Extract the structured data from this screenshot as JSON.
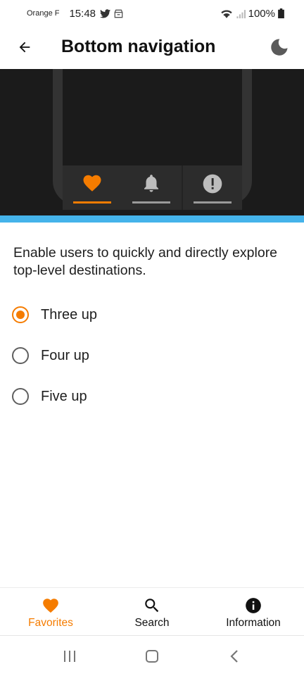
{
  "status_bar": {
    "carrier": "Orange F",
    "time": "15:48",
    "battery": "100%"
  },
  "app_bar": {
    "title": "Bottom navigation"
  },
  "description": "Enable users to quickly and directly explore top-level destinations.",
  "options": [
    {
      "label": "Three up",
      "selected": true
    },
    {
      "label": "Four up",
      "selected": false
    },
    {
      "label": "Five up",
      "selected": false
    }
  ],
  "bottom_nav": {
    "items": [
      {
        "label": "Favorites",
        "icon": "heart-icon",
        "active": true
      },
      {
        "label": "Search",
        "icon": "search-icon",
        "active": false
      },
      {
        "label": "Information",
        "icon": "info-icon",
        "active": false
      }
    ]
  },
  "colors": {
    "accent": "#f57c00",
    "hero_background": "#1b1b1b",
    "hero_stripe": "#45b3ea"
  }
}
